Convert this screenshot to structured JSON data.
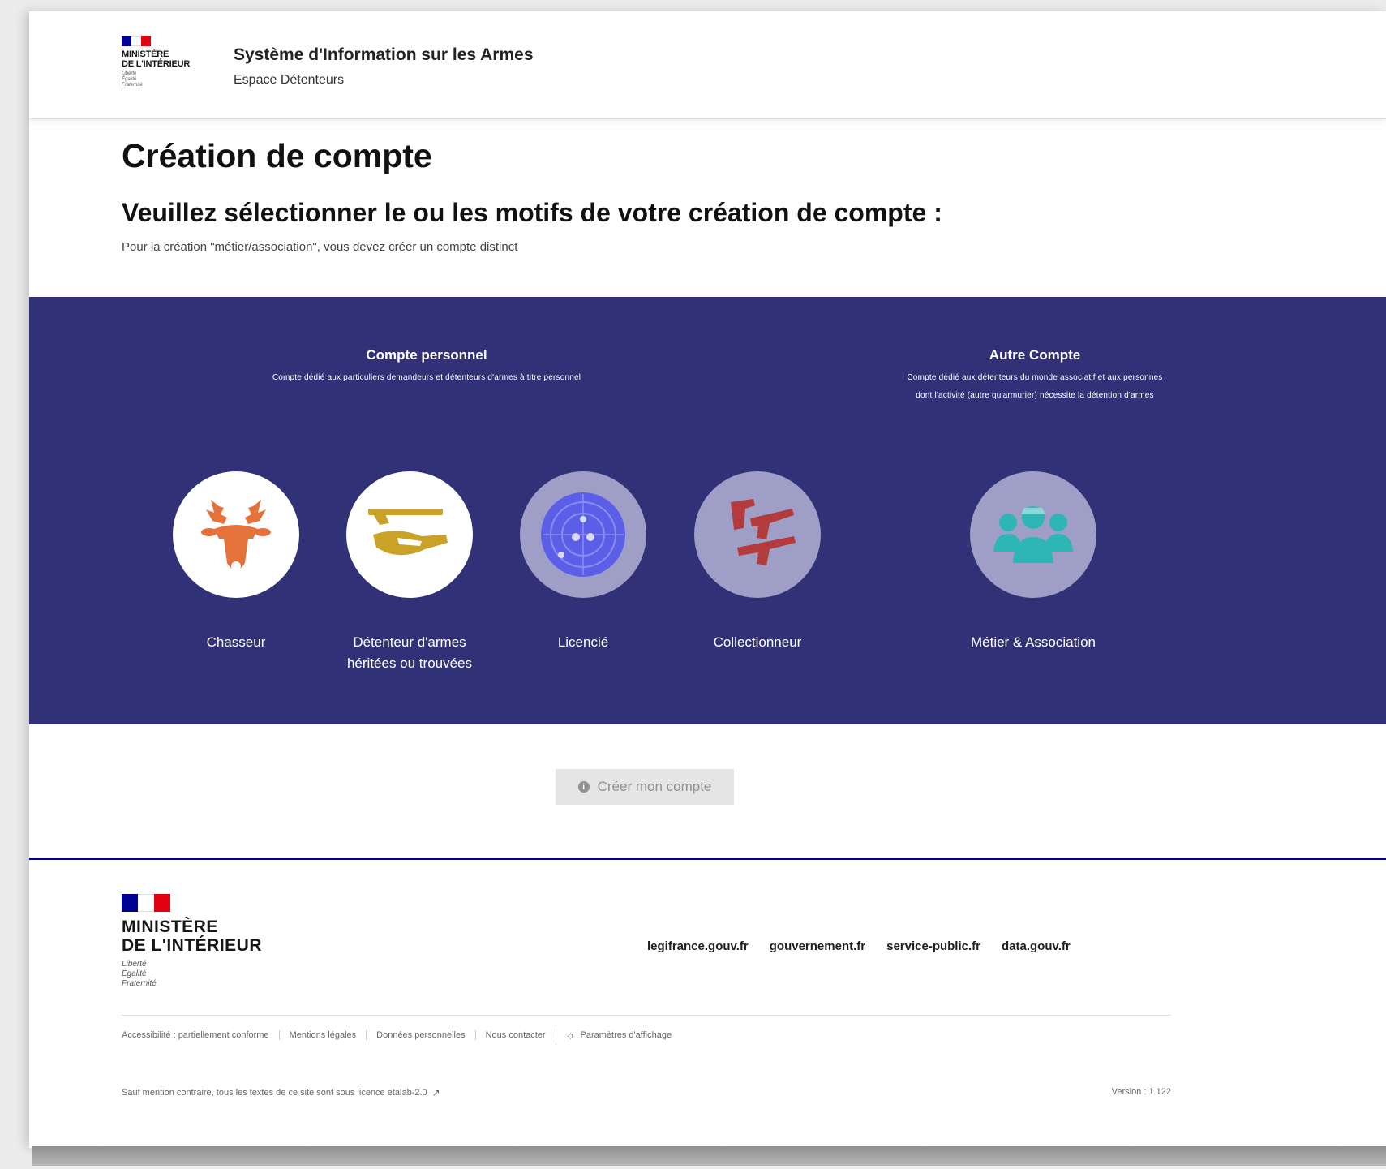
{
  "header": {
    "ministry": [
      "MINISTÈRE",
      "DE L'INTÉRIEUR"
    ],
    "motto": [
      "Liberté",
      "Égalité",
      "Fraternité"
    ],
    "service_title": "Système d'Information sur les Armes",
    "service_subtitle": "Espace Détenteurs"
  },
  "main": {
    "title": "Création de compte",
    "subtitle": "Veuillez sélectionner le ou les motifs de votre création de compte :",
    "hint": "Pour la création \"métier/association\", vous devez créer un compte distinct"
  },
  "groups": {
    "personal": {
      "title": "Compte personnel",
      "description": "Compte dédié aux particuliers demandeurs et détenteurs d'armes à titre personnel"
    },
    "other": {
      "title": "Autre Compte",
      "description_line1": "Compte dédié aux détenteurs du monde associatif et aux personnes",
      "description_line2": "dont l'activité (autre qu'armurier) nécessite la détention d'armes"
    }
  },
  "tiles": [
    {
      "label": "Chasseur",
      "icon": "deer-icon",
      "color": "#e5713b",
      "selected": true
    },
    {
      "label_line1": "Détenteur d'armes",
      "label_line2": "héritées ou trouvées",
      "icon": "rifle-hand-icon",
      "color": "#c9a227",
      "selected": true
    },
    {
      "label": "Licencié",
      "icon": "target-icon",
      "color": "#5b5fe8",
      "selected": false
    },
    {
      "label": "Collectionneur",
      "icon": "guns-icon",
      "color": "#b33b3b",
      "selected": false
    },
    {
      "label": "Métier & Association",
      "icon": "people-group-icon",
      "color": "#2eb5b5",
      "selected": false
    }
  ],
  "create_button": {
    "label": "Créer mon compte",
    "disabled": true
  },
  "footer": {
    "ministry": [
      "MINISTÈRE",
      "DE L'INTÉRIEUR"
    ],
    "motto": [
      "Liberté",
      "Égalité",
      "Fraternité"
    ],
    "links": [
      "legifrance.gouv.fr",
      "gouvernement.fr",
      "service-public.fr",
      "data.gouv.fr"
    ],
    "bottom_links": [
      "Accessibilité : partiellement conforme",
      "Mentions légales",
      "Données personnelles",
      "Nous contacter"
    ],
    "display_settings": "Paramètres d'affichage",
    "license": "Sauf mention contraire, tous les textes de ce site sont sous licence etalab-2.0",
    "version": "Version : 1.122"
  },
  "colors": {
    "primary_blue": "#000091",
    "section_blue": "#313178"
  }
}
